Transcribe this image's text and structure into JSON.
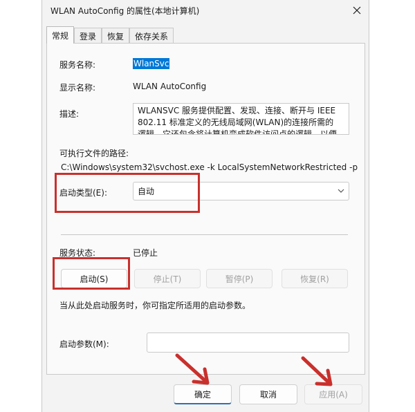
{
  "window": {
    "title": "WLAN AutoConfig 的属性(本地计算机)"
  },
  "tabs": [
    {
      "label": "常规"
    },
    {
      "label": "登录"
    },
    {
      "label": "恢复"
    },
    {
      "label": "依存关系"
    }
  ],
  "general": {
    "service_name_label": "服务名称:",
    "service_name_value": "WlanSvc",
    "display_name_label": "显示名称:",
    "display_name_value": "WLAN AutoConfig",
    "description_label": "描述:",
    "description_lines": [
      "WLANSVC 服务提供配置、发现、连接、断开与 IEEE",
      "802.11 标准定义的无线局域网(WLAN)的连接所需的",
      "逻辑。它还包含将计算机变成软件访问点的逻辑，以便"
    ],
    "exe_path_label": "可执行文件的路径:",
    "exe_path_value": "C:\\Windows\\system32\\svchost.exe -k LocalSystemNetworkRestricted -p",
    "startup_type_label": "启动类型(E):",
    "startup_type_value": "自动",
    "service_status_label": "服务状态:",
    "service_status_value": "已停止",
    "buttons": {
      "start": "启动(S)",
      "stop": "停止(T)",
      "pause": "暂停(P)",
      "resume": "恢复(R)"
    },
    "hint": "当从此处启动服务时，你可指定所适用的启动参数。",
    "start_params_label": "启动参数(M):",
    "start_params_value": ""
  },
  "footer": {
    "ok": "确定",
    "cancel": "取消",
    "apply": "应用(A)"
  },
  "colors": {
    "annotation_red": "#c9302c",
    "selection_blue": "#0078d7"
  }
}
